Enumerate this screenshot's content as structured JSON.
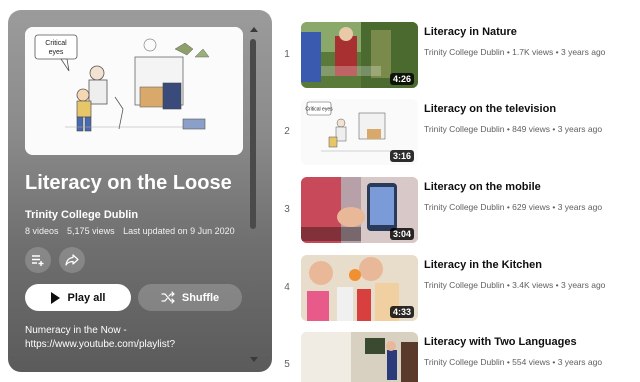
{
  "playlist": {
    "cover_caption": "Critical eyes",
    "title": "Literacy on the Loose",
    "owner": "Trinity College Dublin",
    "video_count": "8 videos",
    "view_count": "5,175 views",
    "last_updated": "Last updated on 9 Jun 2020",
    "play_all_label": "Play all",
    "shuffle_label": "Shuffle",
    "description_line1": "Numeracy in the Now -",
    "description_line2": "https://www.youtube.com/playlist?"
  },
  "videos": [
    {
      "index": "1",
      "title": "Literacy in Nature",
      "channel": "Trinity College Dublin",
      "views": "1.7K views",
      "age": "3 years ago",
      "duration": "4:26"
    },
    {
      "index": "2",
      "title": "Literacy on the television",
      "channel": "Trinity College Dublin",
      "views": "849 views",
      "age": "3 years ago",
      "duration": "3:16",
      "thumb_caption": "Critical eyes"
    },
    {
      "index": "3",
      "title": "Literacy on the mobile",
      "channel": "Trinity College Dublin",
      "views": "629 views",
      "age": "3 years ago",
      "duration": "3:04"
    },
    {
      "index": "4",
      "title": "Literacy in the Kitchen",
      "channel": "Trinity College Dublin",
      "views": "3.4K views",
      "age": "3 years ago",
      "duration": "4:33"
    },
    {
      "index": "5",
      "title": "Literacy with Two Languages",
      "channel": "Trinity College Dublin",
      "views": "554 views",
      "age": "3 years ago"
    }
  ],
  "icons": {
    "save": "playlist-add-icon",
    "share": "share-icon",
    "play": "play-icon",
    "shuffle": "shuffle-icon"
  }
}
